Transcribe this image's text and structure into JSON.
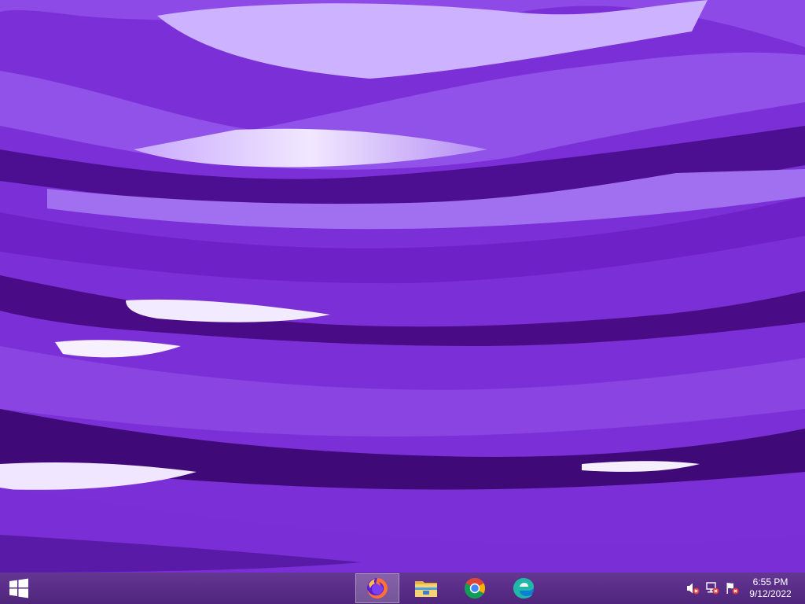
{
  "desktop": {
    "wallpaper": "purple-ribbons-wallpaper",
    "colors": {
      "base": "#7a2ad8",
      "dark": "#4a0d8a",
      "light": "#e4d2ff"
    }
  },
  "taskbar": {
    "color": "#5a2a8c",
    "start": {
      "icon": "windows-logo-icon"
    },
    "pinned": [
      {
        "icon": "firefox-icon",
        "active": true
      },
      {
        "icon": "file-explorer-icon",
        "active": false
      },
      {
        "icon": "chrome-icon",
        "active": false
      },
      {
        "icon": "edge-icon",
        "active": false
      }
    ],
    "tray": {
      "icons": [
        "volume-muted-icon",
        "network-disconnected-icon",
        "action-center-flag-icon"
      ],
      "time": "6:55 PM",
      "date": "9/12/2022"
    }
  }
}
